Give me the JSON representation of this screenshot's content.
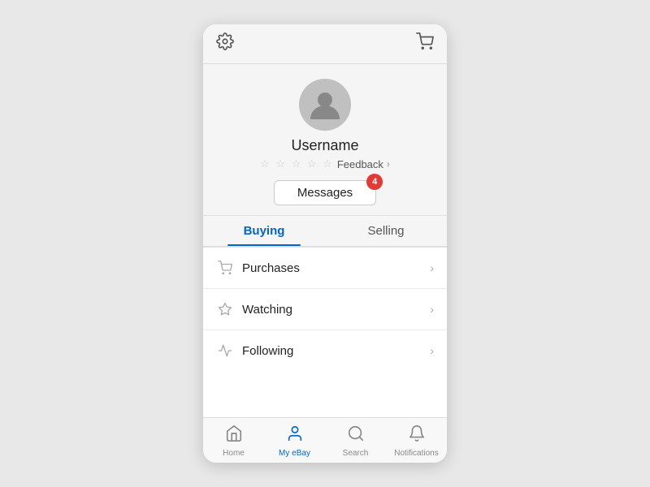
{
  "topBar": {
    "settingsIcon": "⚙",
    "cartIcon": "🛒"
  },
  "profile": {
    "username": "Username",
    "stars": "☆ ☆ ☆ ☆ ☆",
    "feedbackLabel": "Feedback",
    "feedbackChevron": "›",
    "messagesLabel": "Messages",
    "badgeCount": "4"
  },
  "tabs": [
    {
      "id": "buying",
      "label": "Buying",
      "active": true
    },
    {
      "id": "selling",
      "label": "Selling",
      "active": false
    }
  ],
  "menuItems": [
    {
      "id": "purchases",
      "label": "Purchases",
      "iconType": "cart"
    },
    {
      "id": "watching",
      "label": "Watching",
      "iconType": "star"
    },
    {
      "id": "following",
      "label": "Following",
      "iconType": "pulse"
    }
  ],
  "bottomNav": [
    {
      "id": "home",
      "label": "Home",
      "iconType": "home",
      "active": false
    },
    {
      "id": "myebay",
      "label": "My eBay",
      "iconType": "person",
      "active": true
    },
    {
      "id": "search",
      "label": "Search",
      "iconType": "search",
      "active": false
    },
    {
      "id": "notifications",
      "label": "Notifications",
      "iconType": "bell",
      "active": false
    }
  ]
}
